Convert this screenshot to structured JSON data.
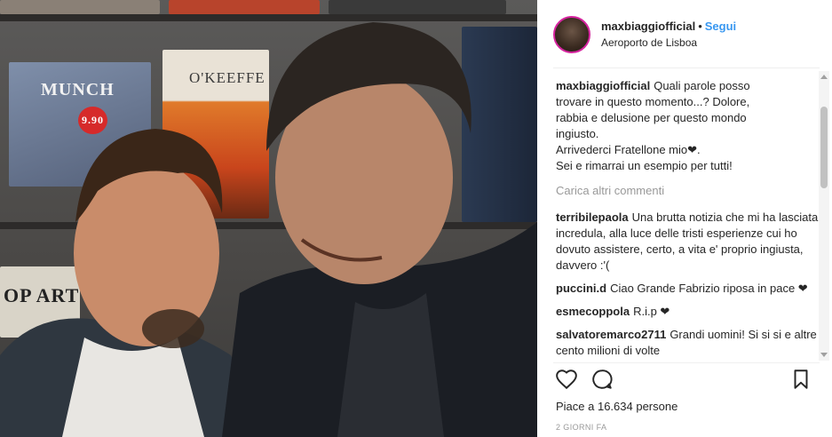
{
  "post": {
    "username": "maxbiaggiofficial",
    "follow_label": "Segui",
    "location": "Aeroporto de Lisboa",
    "photo": {
      "book_labels": [
        "MUNCH",
        "O'KEEFFE",
        "OP ART"
      ],
      "price_tag": "9.90"
    }
  },
  "caption": {
    "user": "maxbiaggiofficial",
    "lines": [
      "Quali parole posso",
      "trovare in questo momento...? Dolore,",
      "rabbia e delusione per questo mondo",
      "ingiusto.",
      "Arrivederci Fratellone mio❤.",
      "Sei e rimarrai un esempio per tutti!"
    ]
  },
  "load_more_label": "Carica altri commenti",
  "comments": [
    {
      "user": "terribilepaola",
      "text": "Una brutta notizia che mi ha lasciata incredula, alla luce delle tristi esperienze cui ho dovuto assistere, certo, a vita e' proprio ingiusta, davvero :'("
    },
    {
      "user": "puccini.d",
      "text": "Ciao Grande Fabrizio riposa in pace ❤"
    },
    {
      "user": "esmecoppola",
      "text": "R.i.p ❤"
    },
    {
      "user": "salvatoremarco2711",
      "text": "Grandi uomini! Si si si e altre cento milioni di volte"
    }
  ],
  "likes_label": "Piace a 16.634 persone",
  "time_label": "2 GIORNI FA",
  "icons": {
    "like": "heart-icon",
    "comment": "comment-bubble-icon",
    "save": "bookmark-icon"
  },
  "colors": {
    "follow": "#3897f0",
    "muted": "#999999",
    "text": "#262626"
  }
}
